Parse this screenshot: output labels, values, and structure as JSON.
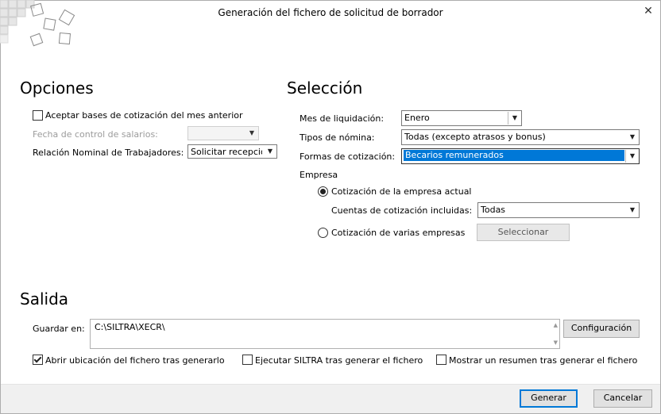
{
  "window": {
    "title": "Generación del fichero de solicitud de borrador",
    "close_glyph": "✕"
  },
  "opciones": {
    "heading": "Opciones",
    "aceptar_bases_label": "Aceptar bases de cotización del mes anterior",
    "aceptar_bases_checked": false,
    "fecha_control_label": "Fecha de control de salarios:",
    "fecha_control_value": "",
    "relacion_label": "Relación Nominal de Trabajadores:",
    "relacion_value": "Solicitar recepció"
  },
  "seleccion": {
    "heading": "Selección",
    "mes_label": "Mes de liquidación:",
    "mes_value": "Enero",
    "tipos_label": "Tipos de nómina:",
    "tipos_value": "Todas (excepto atrasos y bonus)",
    "formas_label": "Formas de cotización:",
    "formas_value": "Becarios remunerados",
    "empresa_label": "Empresa",
    "radio_actual_label": "Cotización de la empresa actual",
    "radio_actual_checked": true,
    "cuentas_label": "Cuentas de cotización incluidas:",
    "cuentas_value": "Todas",
    "radio_varias_label": "Cotización de varias empresas",
    "radio_varias_checked": false,
    "seleccionar_label": "Seleccionar"
  },
  "salida": {
    "heading": "Salida",
    "guardar_label": "Guardar en:",
    "guardar_value": "C:\\SILTRA\\XECR\\",
    "configuracion_label": "Configuración",
    "abrir_label": "Abrir ubicación del fichero tras generarlo",
    "abrir_checked": true,
    "ejecutar_label": "Ejecutar SILTRA tras generar el fichero",
    "ejecutar_checked": false,
    "mostrar_label": "Mostrar un resumen tras generar el fichero",
    "mostrar_checked": false
  },
  "footer": {
    "generar_label": "Generar",
    "cancelar_label": "Cancelar"
  },
  "icons": {
    "dropdown": "▼",
    "scroll_up": "▲",
    "scroll_down": "▼"
  }
}
